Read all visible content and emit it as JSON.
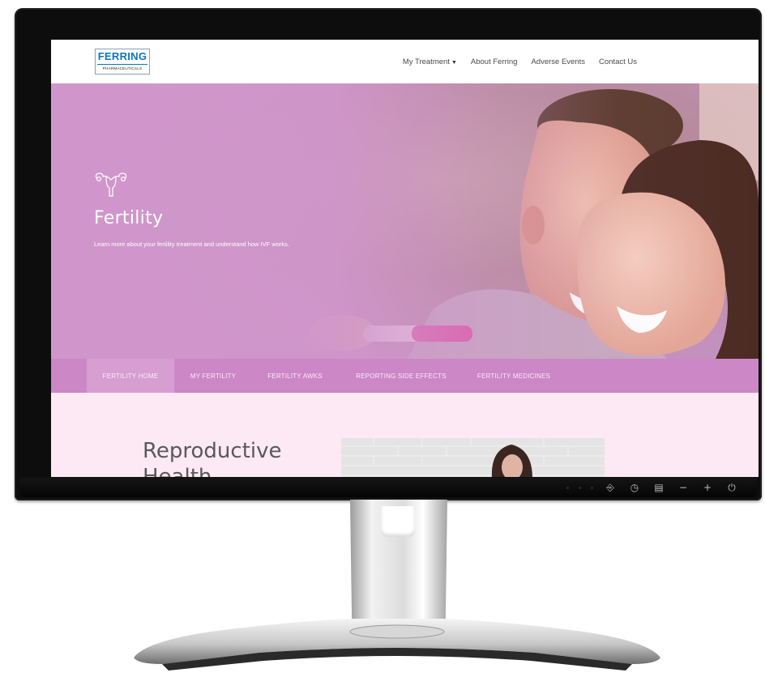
{
  "website": {
    "logo": {
      "name": "FERRING",
      "subtitle": "PHARMACEUTICALS"
    },
    "nav": {
      "items": [
        {
          "label": "My Treatment",
          "has_dropdown": true
        },
        {
          "label": "About Ferring"
        },
        {
          "label": "Adverse Events"
        },
        {
          "label": "Contact Us"
        }
      ]
    },
    "hero": {
      "icon": "uterus-icon",
      "title": "Fertility",
      "subtitle": "Learn more about your fertility treatment and understand how IVF works.",
      "photo": "smiling couple looking at pregnancy test"
    },
    "subnav": {
      "tabs": [
        {
          "label": "FERTILITY HOME",
          "active": true
        },
        {
          "label": "MY FERTILITY"
        },
        {
          "label": "FERTILITY AWKS"
        },
        {
          "label": "REPORTING SIDE EFFECTS"
        },
        {
          "label": "FERTILITY MEDICINES"
        }
      ]
    },
    "content": {
      "heading": "Reproductive Health"
    }
  },
  "monitor": {
    "controls": [
      "input-icon",
      "auto-adjust-icon",
      "menu-icon",
      "minus-icon",
      "plus-icon",
      "power-icon"
    ],
    "control_glyphs": [
      "⎆",
      "◷",
      "▤",
      "−",
      "+",
      "⏻"
    ]
  },
  "colors": {
    "hero_tint": "#d096cc",
    "subnav": "#cc87c6",
    "content_bg": "#fde9f3",
    "logo_blue": "#0a76be"
  }
}
